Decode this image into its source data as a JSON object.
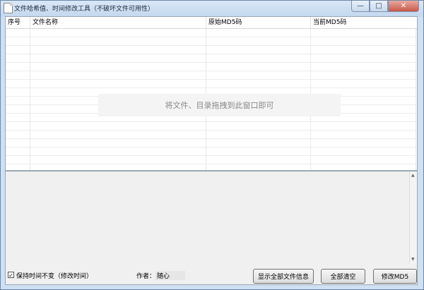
{
  "window": {
    "title": "文件哈希值、时间修改工具（不破坏文件可用性）",
    "controls": {
      "minimize": "—",
      "maximize": "□",
      "close": "✕"
    }
  },
  "table": {
    "columns": [
      "序号",
      "文件名称",
      "原始MD5码",
      "当前MD5码"
    ],
    "rows": [],
    "drop_hint": "将文件、目录拖拽到此窗口即可"
  },
  "log": {
    "text": ""
  },
  "footer": {
    "keep_time_checkbox": {
      "label": "保持时间不变（修改时间）",
      "checked": true
    },
    "author_label": "作者：",
    "author_name": "随心",
    "buttons": {
      "show_all": "显示全部文件信息",
      "clear_all": "全部清空",
      "modify_md5": "修改MD5"
    }
  }
}
